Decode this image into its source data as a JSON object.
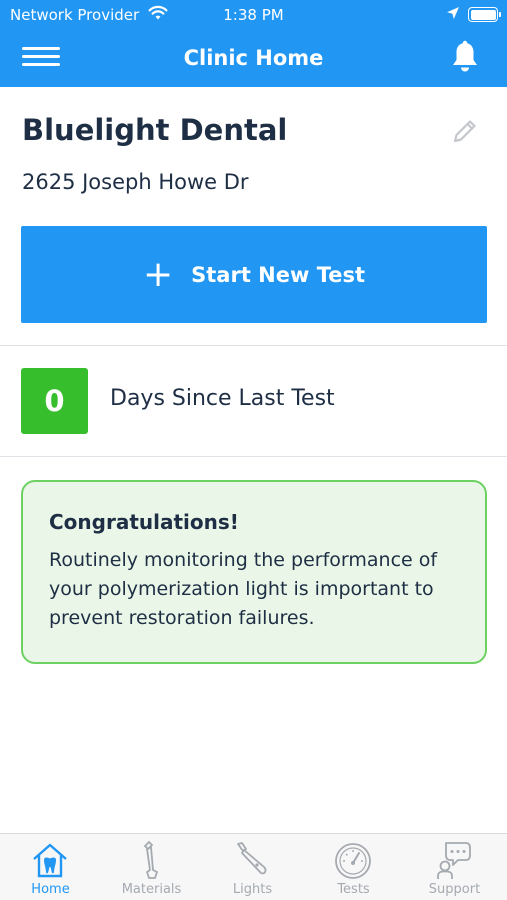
{
  "status_bar": {
    "carrier": "Network Provider",
    "time": "1:38 PM"
  },
  "nav": {
    "title": "Clinic Home"
  },
  "clinic": {
    "name": "Bluelight Dental",
    "address": "2625 Joseph Howe Dr"
  },
  "start_test": {
    "label": "Start New Test"
  },
  "days_since": {
    "count": "0",
    "label": "Days Since Last Test"
  },
  "message": {
    "title": "Congratulations!",
    "body": "Routinely monitoring the performance of your polymerization light is important to prevent restoration failures."
  },
  "tabs": [
    {
      "label": "Home",
      "icon": "tooth-house-icon",
      "active": true
    },
    {
      "label": "Materials",
      "icon": "material-syringe-icon",
      "active": false
    },
    {
      "label": "Lights",
      "icon": "curing-light-icon",
      "active": false
    },
    {
      "label": "Tests",
      "icon": "gauge-icon",
      "active": false
    },
    {
      "label": "Support",
      "icon": "chat-help-icon",
      "active": false
    }
  ],
  "colors": {
    "accent": "#2196f3",
    "success": "#37be2c",
    "card_background": "#eaf7e8",
    "card_border": "#6cd162",
    "tab_inactive": "#a5aab0"
  }
}
